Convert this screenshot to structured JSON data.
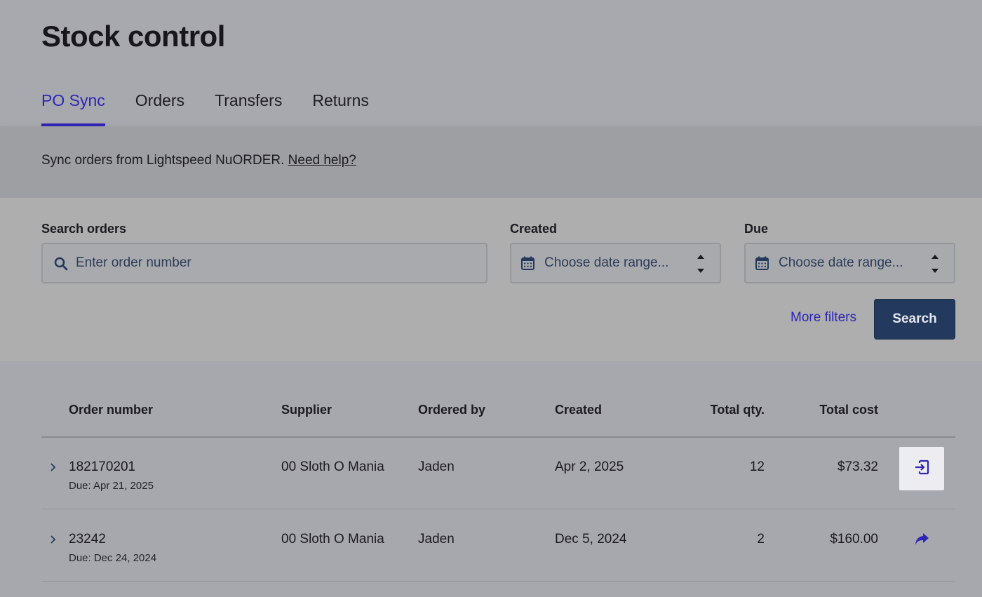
{
  "page": {
    "title": "Stock control"
  },
  "tabs": [
    {
      "label": "PO Sync",
      "active": true
    },
    {
      "label": "Orders",
      "active": false
    },
    {
      "label": "Transfers",
      "active": false
    },
    {
      "label": "Returns",
      "active": false
    }
  ],
  "banner": {
    "text": "Sync orders from Lightspeed NuORDER.",
    "link": "Need help?"
  },
  "filters": {
    "search": {
      "label": "Search orders",
      "placeholder": "Enter order number"
    },
    "created": {
      "label": "Created",
      "placeholder": "Choose date range..."
    },
    "due": {
      "label": "Due",
      "placeholder": "Choose date range..."
    },
    "more_filters": "More filters",
    "search_button": "Search"
  },
  "table": {
    "headers": {
      "order_number": "Order number",
      "supplier": "Supplier",
      "ordered_by": "Ordered by",
      "created": "Created",
      "total_qty": "Total qty.",
      "total_cost": "Total cost"
    },
    "rows": [
      {
        "order_number": "182170201",
        "due": "Due: Apr 21, 2025",
        "supplier": "00 Sloth O Mania",
        "ordered_by": "Jaden",
        "created": "Apr 2, 2025",
        "total_qty": "12",
        "total_cost": "$73.32",
        "action_icon": "import-icon"
      },
      {
        "order_number": "23242",
        "due": "Due: Dec 24, 2024",
        "supplier": "00 Sloth O Mania",
        "ordered_by": "Jaden",
        "created": "Dec 5, 2024",
        "total_qty": "2",
        "total_cost": "$160.00",
        "action_icon": "forward-arrow-icon"
      }
    ]
  },
  "colors": {
    "accent": "#2f25b7",
    "primary_button": "#23395d",
    "page_bg": "#a7a8ad"
  }
}
